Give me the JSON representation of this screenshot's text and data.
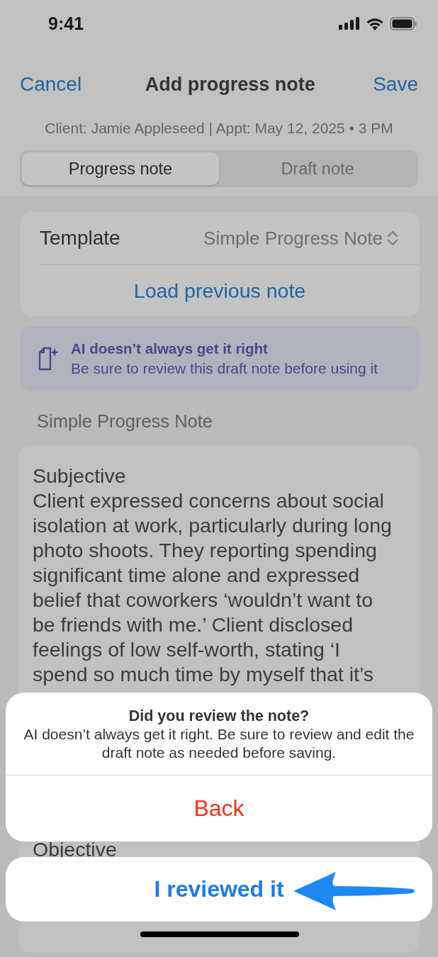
{
  "status_bar": {
    "time": "9:41"
  },
  "nav": {
    "cancel": "Cancel",
    "title": "Add progress note",
    "save": "Save"
  },
  "subtitle": "Client: Jamie Appleseed | Appt: May 12, 2025 • 3 PM",
  "tabs": [
    {
      "label": "Progress note",
      "selected": true
    },
    {
      "label": "Draft note",
      "selected": false
    }
  ],
  "template": {
    "label": "Template",
    "value": "Simple Progress Note"
  },
  "load_button": "Load previous note",
  "ai_banner": {
    "title": "AI doesn’t always get it right",
    "message": "Be sure to review this draft note before using it"
  },
  "section_title": "Simple Progress Note",
  "note": {
    "subjective_heading": "Subjective",
    "subjective_text": "Client expressed concerns about social isolation at work, particularly during long photo shoots. They reporting spending significant time alone and expressed belief that coworkers ‘wouldn’t want to be friends with me.’ Client disclosed feelings of low self-worth, stating ‘I spend so much time by myself that it’s",
    "objective_heading": "Objective"
  },
  "alert": {
    "title": "Did you review the note?",
    "message": "AI doesn’t always get it right. Be sure to review and edit the draft note as needed before saving.",
    "actions": [
      {
        "label": "Back",
        "kind": "destructive"
      },
      {
        "label": "I reviewed it",
        "kind": "confirm"
      }
    ]
  }
}
